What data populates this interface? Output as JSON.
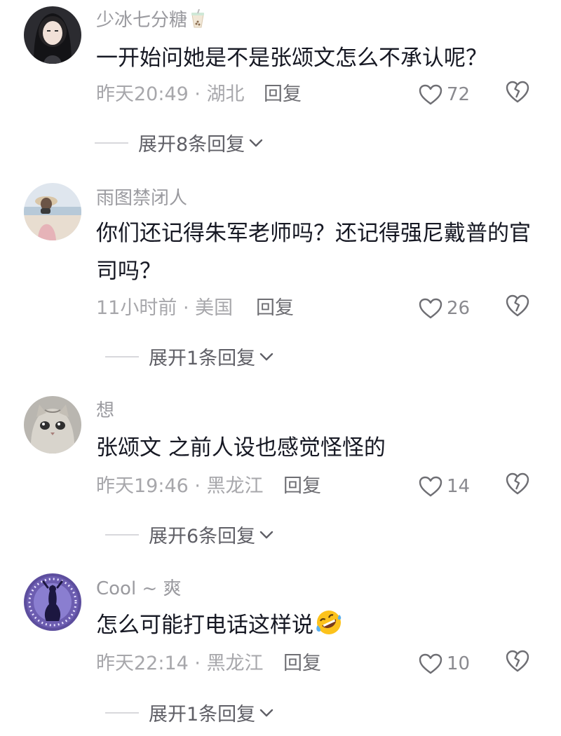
{
  "comments": [
    {
      "username": "少冰七分糖",
      "username_icon": "bubble-tea-icon",
      "text": "一开始问她是不是张颂文怎么不承认呢？",
      "time": "昨天20:49",
      "location": "湖北",
      "reply_label": "回复",
      "likes": "72",
      "expand_label": "展开8条回复"
    },
    {
      "username": "雨图禁闭人",
      "text": "你们还记得朱军老师吗？还记得强尼戴普的官司吗？",
      "time": "11小时前",
      "location": "美国",
      "reply_label": "回复",
      "likes": "26",
      "expand_label": "展开1条回复"
    },
    {
      "username": "想",
      "text": "张颂文 之前人设也感觉怪怪的",
      "time": "昨天19:46",
      "location": "黑龙江",
      "reply_label": "回复",
      "likes": "14",
      "expand_label": "展开6条回复"
    },
    {
      "username": "Cool ~ 爽",
      "text": "怎么可能打电话这样说",
      "text_emoji": "rolling-on-floor-laughing-emoji",
      "time": "昨天22:14",
      "location": "黑龙江",
      "reply_label": "回复",
      "likes": "10",
      "expand_label": "展开1条回复"
    }
  ],
  "meta_separator": " · ",
  "colors": {
    "text": "#161823",
    "username": "#9a9a9f",
    "meta": "#a7a7ab",
    "icon": "#6e6e73"
  }
}
